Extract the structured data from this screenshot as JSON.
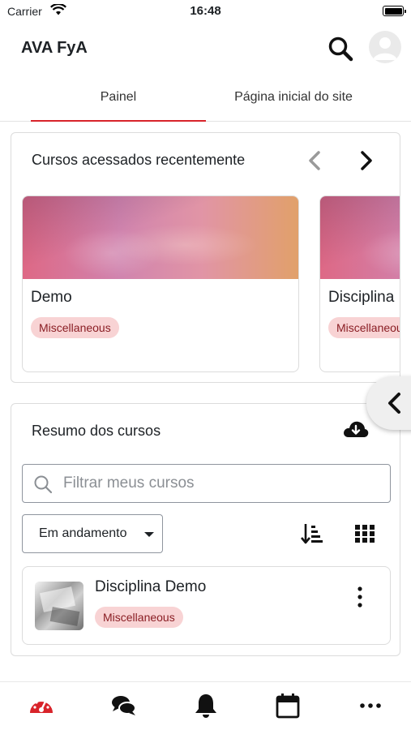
{
  "status_bar": {
    "carrier": "Carrier",
    "time": "16:48"
  },
  "header": {
    "title": "AVA FyA",
    "icons": [
      "search-icon",
      "user-avatar-icon"
    ]
  },
  "tabs": [
    {
      "label": "Painel",
      "active": true
    },
    {
      "label": "Página inicial do site",
      "active": false
    }
  ],
  "recent": {
    "title": "Cursos acessados recentemente",
    "courses": [
      {
        "name": "Demo",
        "category": "Miscellaneous"
      },
      {
        "name": "Disciplina Demo",
        "category": "Miscellaneous"
      }
    ]
  },
  "overview": {
    "title": "Resumo dos cursos",
    "filter_placeholder": "Filtrar meus cursos",
    "status_filter": "Em andamento",
    "courses": [
      {
        "name": "Disciplina Demo",
        "category": "Miscellaneous"
      }
    ]
  },
  "bottom_nav": [
    "dashboard-icon",
    "messages-icon",
    "notifications-icon",
    "calendar-icon",
    "more-icon"
  ],
  "colors": {
    "accent": "#d8232a",
    "badge_bg": "#f8d3d4",
    "badge_text": "#8a1e24"
  }
}
